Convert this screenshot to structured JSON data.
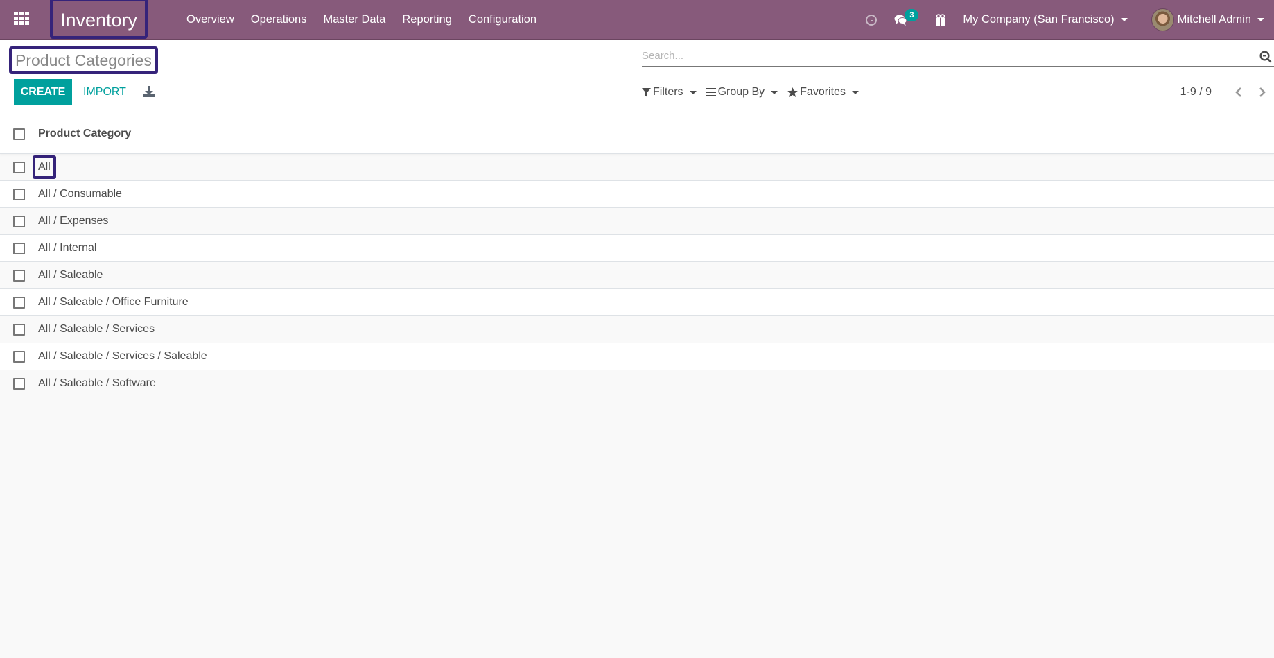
{
  "navbar": {
    "app_name": "Inventory",
    "menu": [
      "Overview",
      "Operations",
      "Master Data",
      "Reporting",
      "Configuration"
    ],
    "icons": {
      "apps": "apps-grid-icon",
      "activity": "clock-icon",
      "messages": "chat-icon",
      "gift": "gift-icon"
    },
    "message_count": "3",
    "company": "My Company (San Francisco)",
    "user": "Mitchell Admin"
  },
  "control_panel": {
    "title": "Product Categories",
    "create_label": "CREATE",
    "import_label": "IMPORT",
    "search_placeholder": "Search...",
    "search_value": "",
    "filters_label": "Filters",
    "group_by_label": "Group By",
    "favorites_label": "Favorites",
    "pager": "1-9 / 9"
  },
  "list": {
    "columns": [
      "Product Category"
    ],
    "rows": [
      "All",
      "All / Consumable",
      "All / Expenses",
      "All / Internal",
      "All / Saleable",
      "All / Saleable / Office Furniture",
      "All / Saleable / Services",
      "All / Saleable / Services / Saleable",
      "All / Saleable / Software"
    ]
  },
  "colors": {
    "brand": "#875a7b",
    "primary": "#00a09d",
    "highlight_box": "#35237a"
  }
}
